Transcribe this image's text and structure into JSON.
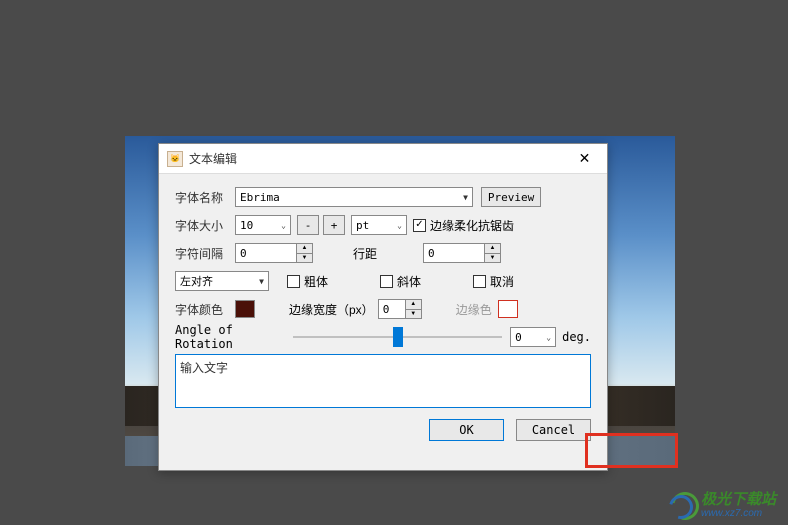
{
  "dialog": {
    "title": "文本编辑",
    "ok": "OK",
    "cancel": "Cancel"
  },
  "font_name": {
    "label": "字体名称",
    "value": "Ebrima",
    "preview": "Preview"
  },
  "font_size": {
    "label": "字体大小",
    "value": "10",
    "unit": "pt",
    "minus": "-",
    "plus": "+"
  },
  "antialias": {
    "label": "边缘柔化抗锯齿",
    "checked": true
  },
  "char_spacing": {
    "label": "字符间隔",
    "value": "0"
  },
  "line_spacing": {
    "label": "行距",
    "value": "0"
  },
  "align": {
    "value": "左对齐"
  },
  "bold": {
    "label": "粗体",
    "checked": false
  },
  "italic": {
    "label": "斜体",
    "checked": false
  },
  "strike": {
    "label": "取消",
    "checked": false
  },
  "font_color": {
    "label": "字体颜色",
    "value": "#4a1008"
  },
  "edge_width": {
    "label": "边缘宽度（px）",
    "value": "0"
  },
  "edge_color": {
    "label": "边缘色",
    "value": "#ffffff",
    "border": "#d03020"
  },
  "rotation": {
    "label": "Angle of Rotation",
    "value": "0",
    "unit": "deg."
  },
  "text_input": {
    "value": "输入文字"
  },
  "watermark": {
    "cn": "极光下载站",
    "en": "www.xz7.com"
  }
}
